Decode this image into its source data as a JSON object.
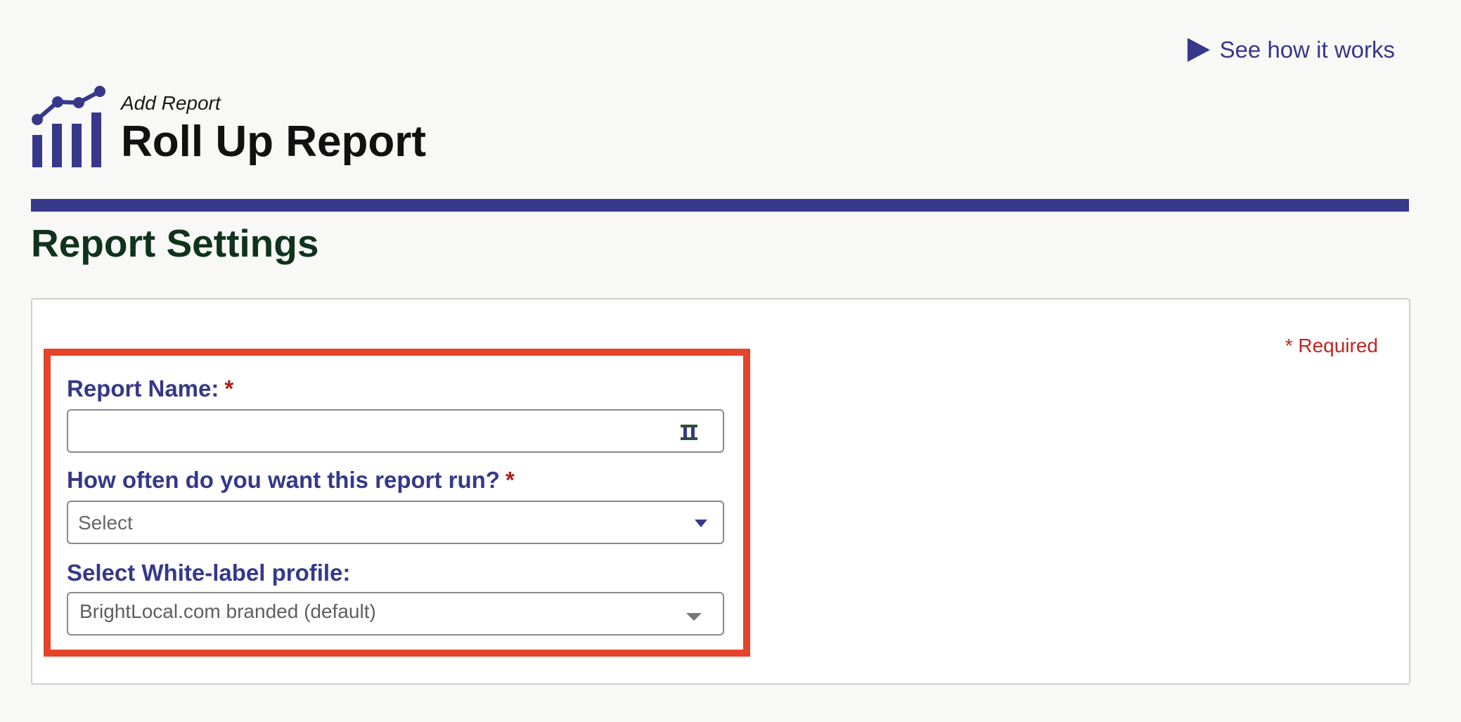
{
  "header": {
    "how_link": "See how it works",
    "subtitle": "Add Report",
    "title": "Roll Up Report"
  },
  "section": {
    "title": "Report Settings",
    "required_note": "* Required"
  },
  "form": {
    "report_name": {
      "label": "Report Name:",
      "required_mark": "*",
      "value": ""
    },
    "frequency": {
      "label": "How often do you want this report run?",
      "required_mark": "*",
      "selected": "Select"
    },
    "white_label": {
      "label": "Select White-label profile:",
      "selected": "BrightLocal.com branded (default)"
    }
  },
  "colors": {
    "brand": "#36388a",
    "heading": "#10331c",
    "required": "#c0261f",
    "highlight": "#e5432a"
  },
  "icons": {
    "how_link": "play-icon",
    "logo": "bar-chart-logo-icon",
    "name_field": "password-manager-icon",
    "dropdown": "chevron-down-icon"
  }
}
